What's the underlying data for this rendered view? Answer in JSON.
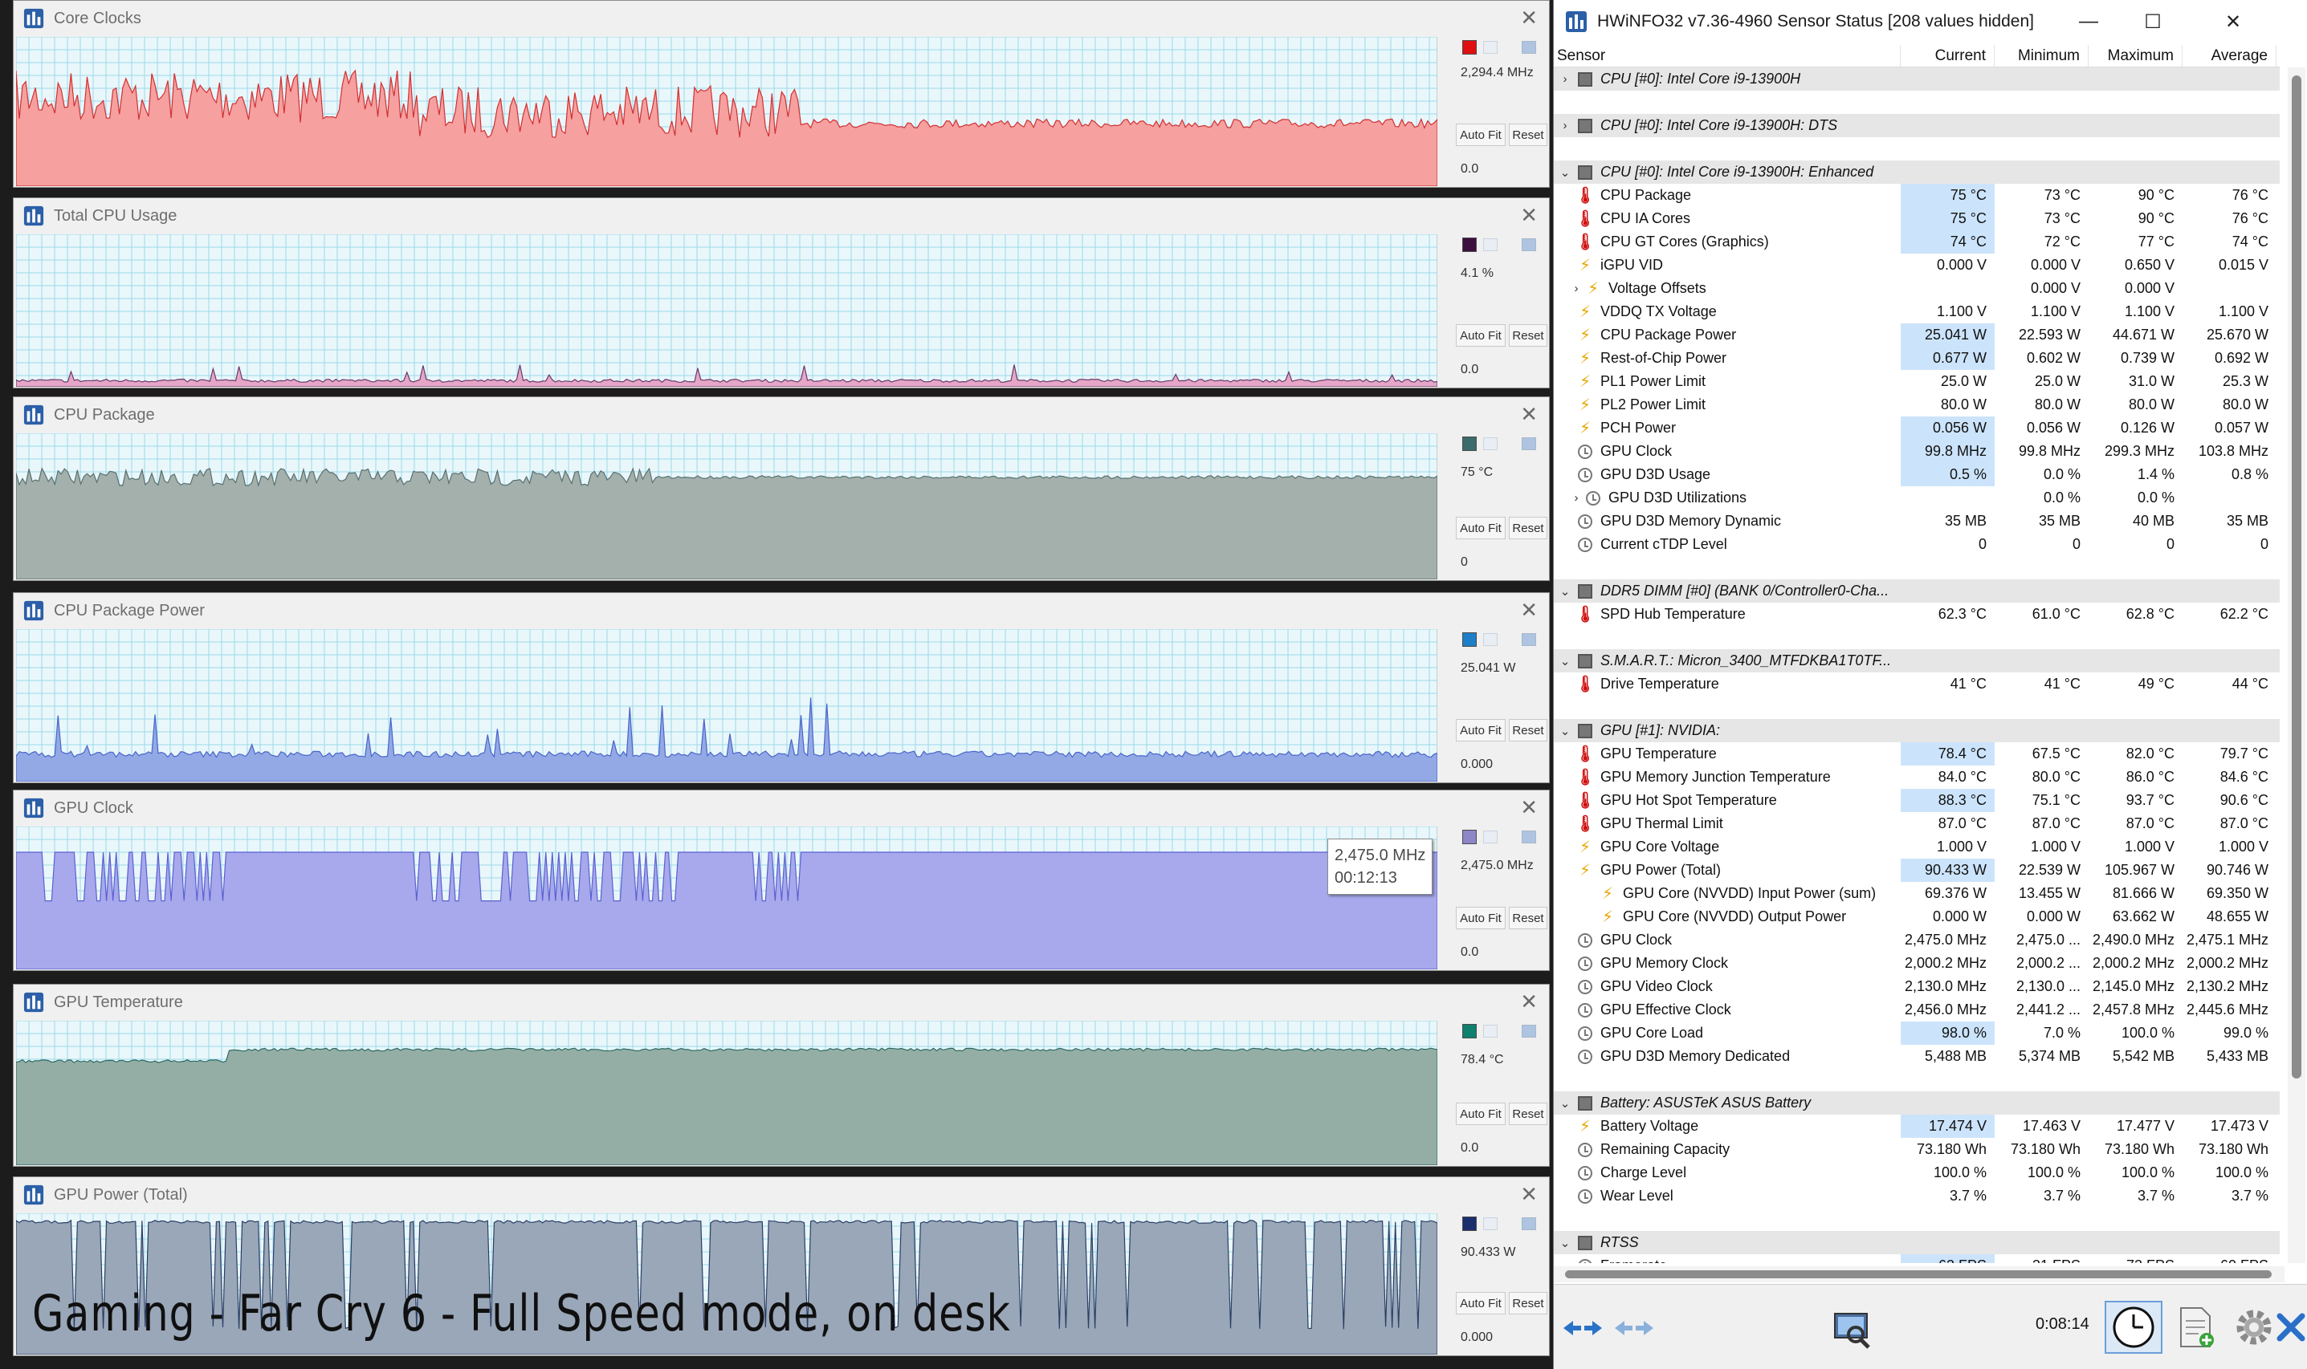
{
  "graphs": [
    {
      "title": "Core Clocks",
      "current": "2,294.4 MHz",
      "min": "0.0",
      "peek": "000",
      "color": "#f6a0a0",
      "line": "#d23030",
      "swatch": "#e01010"
    },
    {
      "title": "Total CPU Usage",
      "current": "4.1 %",
      "min": "0.0",
      "peek": "100.0",
      "color": "#e6a6c8",
      "line": "#6a3a6a",
      "swatch": "#3d0f3f"
    },
    {
      "title": "CPU Package",
      "current": "75 °C",
      "min": "0",
      "peek": "",
      "color": "#a3b0ac",
      "line": "#5a7070",
      "swatch": "#3c6b6b"
    },
    {
      "title": "CPU Package Power",
      "current": "25.041 W",
      "min": "0.000",
      "peek": "150.000",
      "color": "#93a9e6",
      "line": "#4a64c8",
      "swatch": "#1e7fc8"
    },
    {
      "title": "GPU Clock",
      "current": "2,475.0 MHz",
      "min": "0.0",
      "peek": "000",
      "color": "#a7a9ec",
      "line": "#5c5fd0",
      "swatch": "#8d86c9"
    },
    {
      "title": "GPU Temperature",
      "current": "78.4 °C",
      "min": "0.0",
      "peek": "100.0",
      "color": "#94aea6",
      "line": "#2c6a60",
      "swatch": "#0f8070"
    },
    {
      "title": "GPU Power (Total)",
      "current": "90.433 W",
      "min": "0.000",
      "peek": "150.000",
      "color": "#9aa7b8",
      "line": "#2b3f66",
      "swatch": "#1a2e6e"
    }
  ],
  "graph_buttons": {
    "autofit": "Auto Fit",
    "reset": "Reset"
  },
  "tooltip": {
    "value": "2,475.0 MHz",
    "time": "00:12:13"
  },
  "caption": "Gaming - Far Cry 6 - Full Speed mode, on desk",
  "hwinfo": {
    "title": "HWiNFO32 v7.36-4960 Sensor Status [208 values hidden]",
    "columns": [
      "Sensor",
      "Current",
      "Minimum",
      "Maximum",
      "Average"
    ],
    "rows": [
      {
        "type": "group",
        "chev": "›",
        "label": "CPU [#0]: Intel Core i9-13900H"
      },
      {
        "type": "spacer"
      },
      {
        "type": "group",
        "chev": "›",
        "label": "CPU [#0]: Intel Core i9-13900H: DTS"
      },
      {
        "type": "spacer"
      },
      {
        "type": "group",
        "chev": "⌄",
        "label": "CPU [#0]: Intel Core i9-13900H: Enhanced"
      },
      {
        "type": "row",
        "icon": "temp",
        "label": "CPU Package",
        "cur": "75 °C",
        "min": "73 °C",
        "max": "90 °C",
        "avg": "76 °C",
        "hl": true
      },
      {
        "type": "row",
        "icon": "temp",
        "label": "CPU IA Cores",
        "cur": "75 °C",
        "min": "73 °C",
        "max": "90 °C",
        "avg": "76 °C",
        "hl": true
      },
      {
        "type": "row",
        "icon": "temp",
        "label": "CPU GT Cores (Graphics)",
        "cur": "74 °C",
        "min": "72 °C",
        "max": "77 °C",
        "avg": "74 °C",
        "hl": true
      },
      {
        "type": "row",
        "icon": "volt",
        "label": "iGPU VID",
        "cur": "0.000 V",
        "min": "0.000 V",
        "max": "0.650 V",
        "avg": "0.015 V"
      },
      {
        "type": "row",
        "icon": "volt",
        "sub": true,
        "chev": "›",
        "label": "Voltage Offsets",
        "cur": "",
        "min": "0.000 V",
        "max": "0.000 V",
        "avg": ""
      },
      {
        "type": "row",
        "icon": "volt",
        "label": "VDDQ TX Voltage",
        "cur": "1.100 V",
        "min": "1.100 V",
        "max": "1.100 V",
        "avg": "1.100 V"
      },
      {
        "type": "row",
        "icon": "volt",
        "label": "CPU Package Power",
        "cur": "25.041 W",
        "min": "22.593 W",
        "max": "44.671 W",
        "avg": "25.670 W",
        "hl": true
      },
      {
        "type": "row",
        "icon": "volt",
        "label": "Rest-of-Chip Power",
        "cur": "0.677 W",
        "min": "0.602 W",
        "max": "0.739 W",
        "avg": "0.692 W",
        "hl": true
      },
      {
        "type": "row",
        "icon": "volt",
        "label": "PL1 Power Limit",
        "cur": "25.0 W",
        "min": "25.0 W",
        "max": "31.0 W",
        "avg": "25.3 W"
      },
      {
        "type": "row",
        "icon": "volt",
        "label": "PL2 Power Limit",
        "cur": "80.0 W",
        "min": "80.0 W",
        "max": "80.0 W",
        "avg": "80.0 W"
      },
      {
        "type": "row",
        "icon": "volt",
        "label": "PCH Power",
        "cur": "0.056 W",
        "min": "0.056 W",
        "max": "0.126 W",
        "avg": "0.057 W",
        "hl": true
      },
      {
        "type": "row",
        "icon": "clock",
        "label": "GPU Clock",
        "cur": "99.8 MHz",
        "min": "99.8 MHz",
        "max": "299.3 MHz",
        "avg": "103.8 MHz",
        "hl": true
      },
      {
        "type": "row",
        "icon": "clock",
        "label": "GPU D3D Usage",
        "cur": "0.5 %",
        "min": "0.0 %",
        "max": "1.4 %",
        "avg": "0.8 %",
        "hl": true
      },
      {
        "type": "row",
        "icon": "clock",
        "sub": true,
        "chev": "›",
        "label": "GPU D3D Utilizations",
        "cur": "",
        "min": "0.0 %",
        "max": "0.0 %",
        "avg": ""
      },
      {
        "type": "row",
        "icon": "clock",
        "label": "GPU D3D Memory Dynamic",
        "cur": "35 MB",
        "min": "35 MB",
        "max": "40 MB",
        "avg": "35 MB"
      },
      {
        "type": "row",
        "icon": "clock",
        "label": "Current cTDP Level",
        "cur": "0",
        "min": "0",
        "max": "0",
        "avg": "0"
      },
      {
        "type": "spacer"
      },
      {
        "type": "group",
        "chev": "⌄",
        "label": "DDR5 DIMM [#0] (BANK 0/Controller0-Cha..."
      },
      {
        "type": "row",
        "icon": "temp",
        "label": "SPD Hub Temperature",
        "cur": "62.3 °C",
        "min": "61.0 °C",
        "max": "62.8 °C",
        "avg": "62.2 °C"
      },
      {
        "type": "spacer"
      },
      {
        "type": "group",
        "chev": "⌄",
        "label": "S.M.A.R.T.: Micron_3400_MTFDKBA1T0TF..."
      },
      {
        "type": "row",
        "icon": "temp",
        "label": "Drive Temperature",
        "cur": "41 °C",
        "min": "41 °C",
        "max": "49 °C",
        "avg": "44 °C"
      },
      {
        "type": "spacer"
      },
      {
        "type": "group",
        "chev": "⌄",
        "label": "GPU [#1]: NVIDIA:"
      },
      {
        "type": "row",
        "icon": "temp",
        "label": "GPU Temperature",
        "cur": "78.4 °C",
        "min": "67.5 °C",
        "max": "82.0 °C",
        "avg": "79.7 °C",
        "hl": true
      },
      {
        "type": "row",
        "icon": "temp",
        "label": "GPU Memory Junction Temperature",
        "cur": "84.0 °C",
        "min": "80.0 °C",
        "max": "86.0 °C",
        "avg": "84.6 °C"
      },
      {
        "type": "row",
        "icon": "temp",
        "label": "GPU Hot Spot Temperature",
        "cur": "88.3 °C",
        "min": "75.1 °C",
        "max": "93.7 °C",
        "avg": "90.6 °C",
        "hl": true
      },
      {
        "type": "row",
        "icon": "temp",
        "label": "GPU Thermal Limit",
        "cur": "87.0 °C",
        "min": "87.0 °C",
        "max": "87.0 °C",
        "avg": "87.0 °C"
      },
      {
        "type": "row",
        "icon": "volt",
        "label": "GPU Core Voltage",
        "cur": "1.000 V",
        "min": "1.000 V",
        "max": "1.000 V",
        "avg": "1.000 V"
      },
      {
        "type": "row",
        "icon": "volt",
        "label": "GPU Power (Total)",
        "cur": "90.433 W",
        "min": "22.539 W",
        "max": "105.967 W",
        "avg": "90.746 W",
        "hl": true
      },
      {
        "type": "row",
        "icon": "volt",
        "sub": true,
        "label": "GPU Core (NVVDD) Input Power (sum)",
        "cur": "69.376 W",
        "min": "13.455 W",
        "max": "81.666 W",
        "avg": "69.350 W"
      },
      {
        "type": "row",
        "icon": "volt",
        "sub": true,
        "label": "GPU Core (NVVDD) Output Power",
        "cur": "0.000 W",
        "min": "0.000 W",
        "max": "63.662 W",
        "avg": "48.655 W"
      },
      {
        "type": "row",
        "icon": "clock",
        "label": "GPU Clock",
        "cur": "2,475.0 MHz",
        "min": "2,475.0 ...",
        "max": "2,490.0 MHz",
        "avg": "2,475.1 MHz"
      },
      {
        "type": "row",
        "icon": "clock",
        "label": "GPU Memory Clock",
        "cur": "2,000.2 MHz",
        "min": "2,000.2 ...",
        "max": "2,000.2 MHz",
        "avg": "2,000.2 MHz"
      },
      {
        "type": "row",
        "icon": "clock",
        "label": "GPU Video Clock",
        "cur": "2,130.0 MHz",
        "min": "2,130.0 ...",
        "max": "2,145.0 MHz",
        "avg": "2,130.2 MHz"
      },
      {
        "type": "row",
        "icon": "clock",
        "label": "GPU Effective Clock",
        "cur": "2,456.0 MHz",
        "min": "2,441.2 ...",
        "max": "2,457.8 MHz",
        "avg": "2,445.6 MHz"
      },
      {
        "type": "row",
        "icon": "clock",
        "label": "GPU Core Load",
        "cur": "98.0 %",
        "min": "7.0 %",
        "max": "100.0 %",
        "avg": "99.0 %",
        "hl": true
      },
      {
        "type": "row",
        "icon": "clock",
        "label": "GPU D3D Memory Dedicated",
        "cur": "5,488 MB",
        "min": "5,374 MB",
        "max": "5,542 MB",
        "avg": "5,433 MB"
      },
      {
        "type": "spacer"
      },
      {
        "type": "group",
        "chev": "⌄",
        "label": "Battery: ASUSTeK ASUS Battery"
      },
      {
        "type": "row",
        "icon": "volt",
        "label": "Battery Voltage",
        "cur": "17.474 V",
        "min": "17.463 V",
        "max": "17.477 V",
        "avg": "17.473 V",
        "hl": true
      },
      {
        "type": "row",
        "icon": "clock",
        "label": "Remaining Capacity",
        "cur": "73.180 Wh",
        "min": "73.180 Wh",
        "max": "73.180 Wh",
        "avg": "73.180 Wh"
      },
      {
        "type": "row",
        "icon": "clock",
        "label": "Charge Level",
        "cur": "100.0 %",
        "min": "100.0 %",
        "max": "100.0 %",
        "avg": "100.0 %"
      },
      {
        "type": "row",
        "icon": "clock",
        "label": "Wear Level",
        "cur": "3.7 %",
        "min": "3.7 %",
        "max": "3.7 %",
        "avg": "3.7 %"
      },
      {
        "type": "spacer"
      },
      {
        "type": "group",
        "chev": "⌄",
        "label": "RTSS"
      },
      {
        "type": "row",
        "icon": "clock",
        "label": "Framerate",
        "cur": "62 FPS",
        "min": "31 FPS",
        "max": "73 FPS",
        "avg": "60 FPS",
        "hl": true
      }
    ],
    "timer": "0:08:14",
    "icons": [
      "arrows-left-right-icon",
      "arrows-disabled-icon",
      "monitor-search-icon",
      "clock-icon",
      "add-report-icon",
      "gear-icon",
      "close-x-icon"
    ]
  }
}
